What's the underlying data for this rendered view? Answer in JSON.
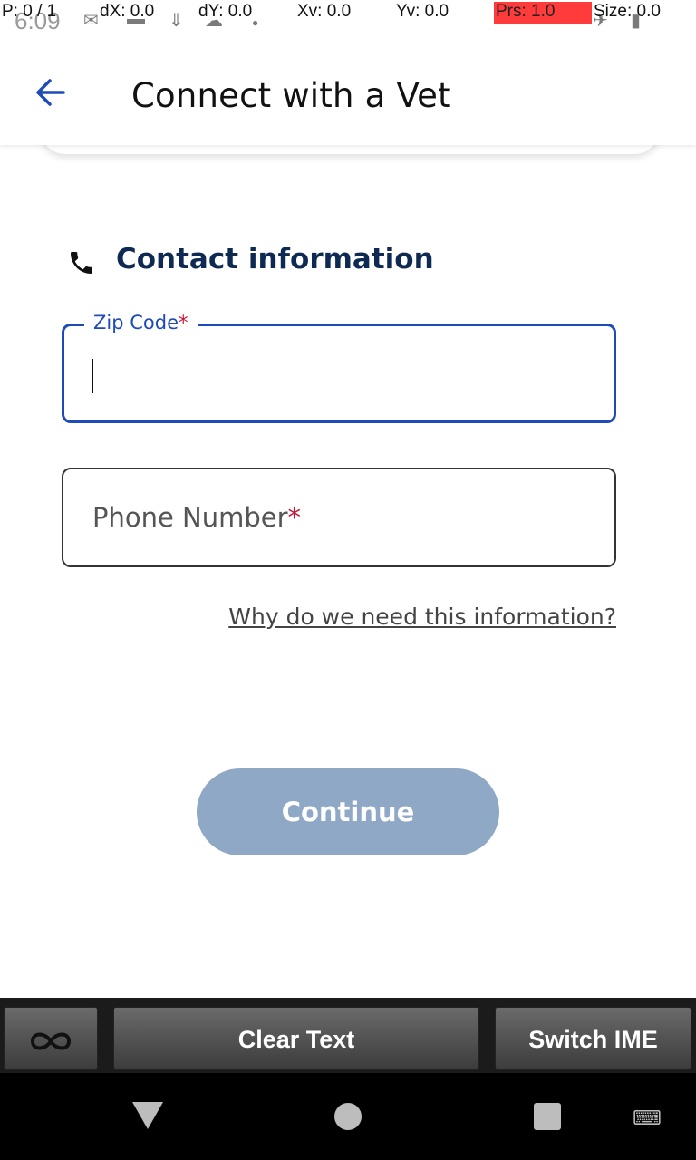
{
  "status_bar": {
    "time": "6:09",
    "pointer": {
      "p": "P: 0 / 1",
      "dx": "dX: 0.0",
      "dy": "dY: 0.0",
      "xv": "Xv: 0.0",
      "yv": "Yv: 0.0",
      "prs": "Prs: 1.0",
      "size": "Size: 0.0"
    },
    "icons": [
      "gmail-icon",
      "car-icon",
      "download-icon",
      "cloud-icon",
      "dot-icon",
      "wifi-icon",
      "airplane-icon",
      "battery-icon"
    ]
  },
  "app_bar": {
    "title": "Connect with a Vet",
    "back_icon": "arrow-left-icon"
  },
  "form": {
    "section_title": "Contact information",
    "section_icon": "phone-icon",
    "zip_label": "Zip Code",
    "zip_required": "*",
    "zip_value": "",
    "phone_placeholder": "Phone Number",
    "phone_required": "*",
    "why_link": "Why do we need this information?",
    "continue_label": "Continue"
  },
  "keyboard_bar": {
    "infinity_icon": "infinity-icon",
    "clear_text": "Clear Text",
    "switch_ime": "Switch IME"
  },
  "nav_bar": {
    "icons": [
      "back-triangle-icon",
      "home-circle-icon",
      "recents-square-icon",
      "keyboard-icon"
    ]
  },
  "colors": {
    "accent": "#1f4bb8",
    "heading": "#0e2a52",
    "required": "#c3173a",
    "button_disabled": "#8fa8c6"
  }
}
